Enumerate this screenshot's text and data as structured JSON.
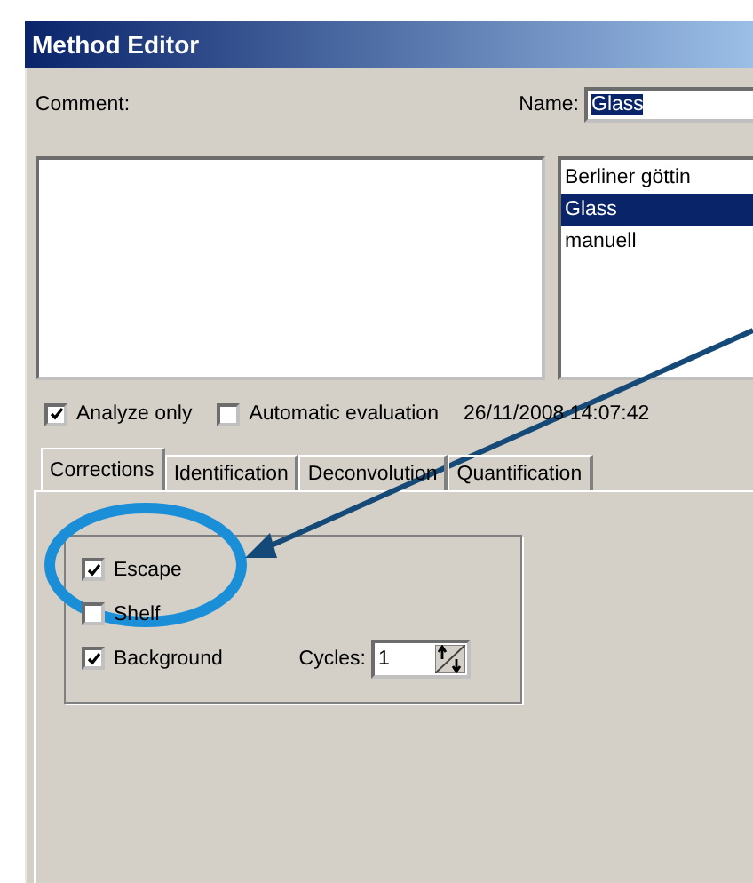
{
  "window": {
    "title": "Method Editor"
  },
  "comment": {
    "label": "Comment:"
  },
  "name": {
    "label": "Name:",
    "value": "Glass"
  },
  "methods": [
    {
      "label": "Berliner göttin",
      "selected": false
    },
    {
      "label": "Glass",
      "selected": true
    },
    {
      "label": "manuell",
      "selected": false
    }
  ],
  "options": [
    {
      "label": "Analyze only",
      "checked": true
    },
    {
      "label": "Automatic evaluation",
      "checked": false
    }
  ],
  "timestamp": "26/11/2008 14:07:42",
  "tabs": [
    {
      "label": "Corrections",
      "selected": true
    },
    {
      "label": "Identification",
      "selected": false
    },
    {
      "label": "Deconvolution",
      "selected": false
    },
    {
      "label": "Quantification",
      "selected": false
    }
  ],
  "corrections": [
    {
      "label": "Escape",
      "checked": true
    },
    {
      "label": "Shelf",
      "checked": false
    },
    {
      "label": "Background",
      "checked": true
    }
  ],
  "cycles": {
    "label": "Cycles:",
    "value": "1"
  }
}
